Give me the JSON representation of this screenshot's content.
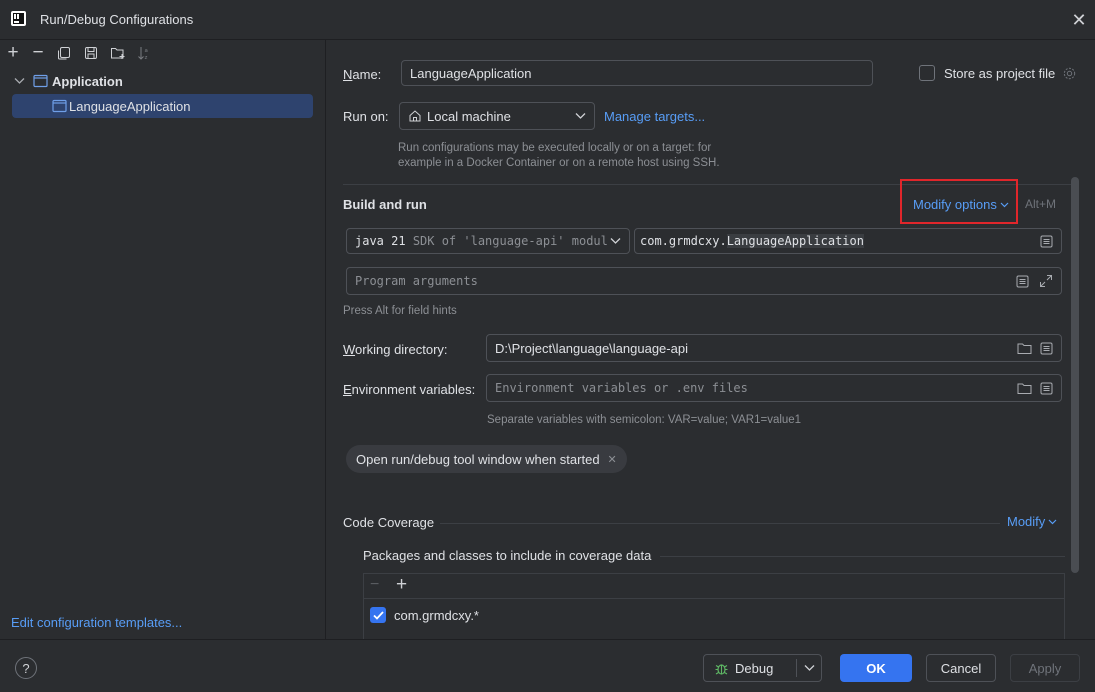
{
  "window": {
    "title": "Run/Debug Configurations",
    "icon": "intellij-icon"
  },
  "left": {
    "tree_root": "Application",
    "tree_child": "LanguageApplication",
    "edit_templates": "Edit configuration templates..."
  },
  "form": {
    "name_label": "Name:",
    "name_value": "LanguageApplication",
    "store_label": "Store as project file",
    "run_on_label": "Run on:",
    "run_on_value": "Local machine",
    "manage_targets": "Manage targets...",
    "run_on_hint_1": "Run configurations may be executed locally or on a target: for",
    "run_on_hint_2": "example in a Docker Container or on a remote host using SSH.",
    "build_title": "Build and run",
    "modify_options": "Modify options",
    "modify_shortcut": "Alt+M",
    "jdk_version": "java 21",
    "jdk_detail": "SDK of 'language-api' modul",
    "main_class_pkg": "com.grmdcxy.",
    "main_class_name": "LanguageApplication",
    "program_args_placeholder": "Program arguments",
    "alt_hint": "Press Alt for field hints",
    "working_dir_label": "Working directory:",
    "working_dir_value": "D:\\Project\\language\\language-api",
    "env_label": "Environment variables:",
    "env_placeholder": "Environment variables or .env files",
    "env_hint": "Separate variables with semicolon: VAR=value; VAR1=value1",
    "open_tool_window_tag": "Open run/debug tool window when started",
    "coverage_title": "Code Coverage",
    "coverage_modify": "Modify",
    "coverage_packages_title": "Packages and classes to include in coverage data",
    "coverage_item": "com.grmdcxy.*",
    "coverage_item_checked": true
  },
  "footer": {
    "debug": "Debug",
    "ok": "OK",
    "cancel": "Cancel",
    "apply": "Apply"
  },
  "colors": {
    "accent": "#3574f0",
    "link": "#589df6",
    "highlight_box": "#e0262b",
    "selection": "#2e436e"
  }
}
